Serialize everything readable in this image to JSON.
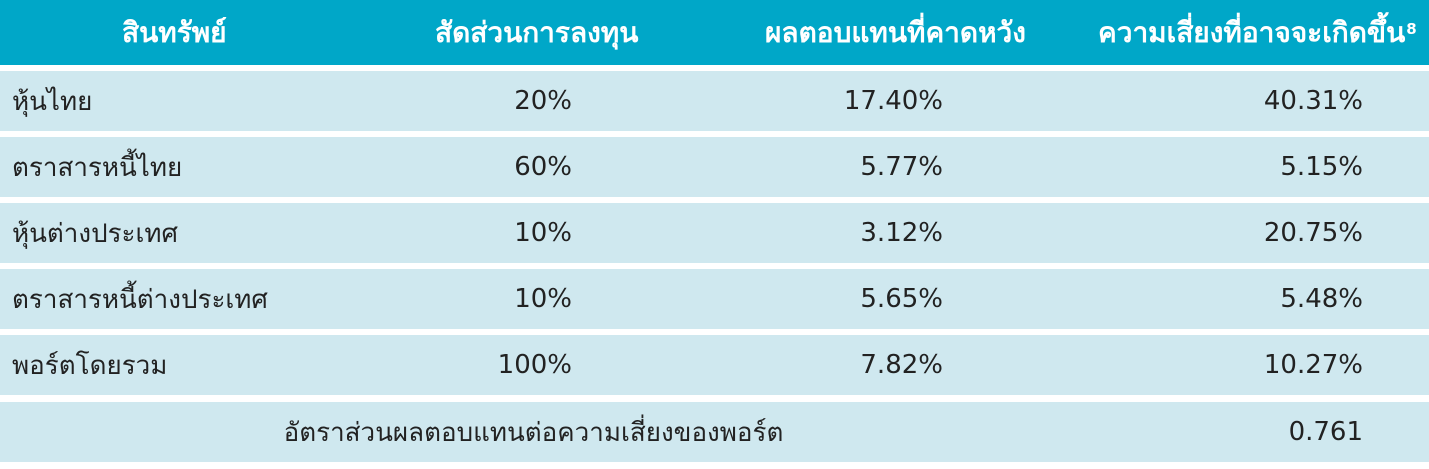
{
  "table": {
    "headers": [
      "สินทรัพย์",
      "สัดส่วนการลงทุน",
      "ผลตอบแทนที่คาดหวัง",
      "ความเสี่ยงที่อาจจะเกิดขึ้น"
    ],
    "risk_footnote": "8",
    "rows": [
      {
        "asset": "หุ้นไทย",
        "allocation": "20%",
        "expected_return": "17.40%",
        "risk": "40.31%"
      },
      {
        "asset": "ตราสารหนี้ไทย",
        "allocation": "60%",
        "expected_return": "5.77%",
        "risk": "5.15%"
      },
      {
        "asset": "หุ้นต่างประเทศ",
        "allocation": "10%",
        "expected_return": "3.12%",
        "risk": "20.75%"
      },
      {
        "asset": "ตราสารหนี้ต่างประเทศ",
        "allocation": "10%",
        "expected_return": "5.65%",
        "risk": "5.48%"
      },
      {
        "asset": "พอร์ตโดยรวม",
        "allocation": "100%",
        "expected_return": "7.82%",
        "risk": "10.27%"
      }
    ],
    "summary": {
      "label": "อัตราส่วนผลตอบแทนต่อความเสี่ยงของพอร์ต",
      "value": "0.761"
    }
  }
}
